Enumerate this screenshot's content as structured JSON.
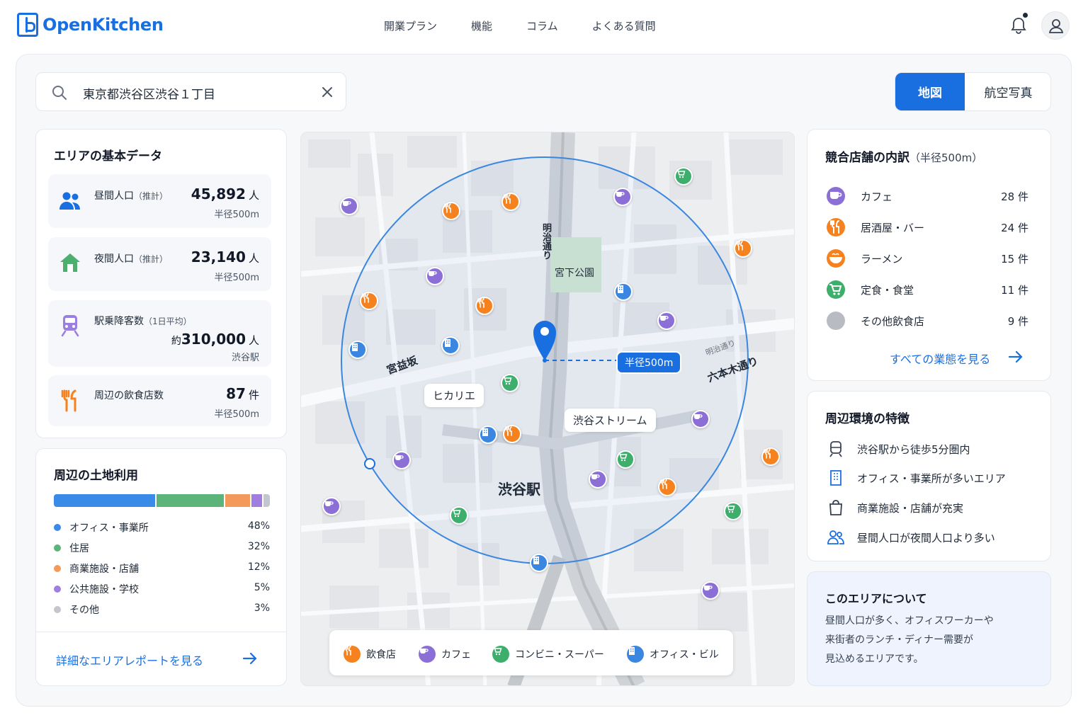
{
  "header": {
    "logo": "OpenKitchen",
    "nav": [
      "開業プラン",
      "機能",
      "コラム",
      "よくある質問"
    ]
  },
  "search": {
    "value": "東京都渋谷区渋谷１丁目"
  },
  "view_toggle": {
    "active": "地図",
    "inactive": "航空写真"
  },
  "basic_data": {
    "title": "エリアの基本データ",
    "items": [
      {
        "label": "昼間人口",
        "note": "（推計）",
        "value": "45,892",
        "unit": "人",
        "sub": "半径500m",
        "icon": "people-icon"
      },
      {
        "label": "夜間人口",
        "note": "（推計）",
        "value": "23,140",
        "unit": "人",
        "sub": "半径500m",
        "icon": "house-icon"
      },
      {
        "label": "駅乗降客数",
        "note": "（1日平均）",
        "prefix": "約",
        "value": "310,000",
        "unit": "人",
        "sub": "渋谷駅",
        "icon": "train-icon"
      },
      {
        "label": "周辺の飲食店数",
        "note": "",
        "value": "87",
        "unit": "件",
        "sub": "半径500m",
        "icon": "fork-knife-icon"
      }
    ]
  },
  "land_use": {
    "title": "周辺の土地利用",
    "items": [
      {
        "name": "オフィス・事業所",
        "percent": "48%",
        "value": 48,
        "color": "#3a8ae8"
      },
      {
        "name": "住居",
        "percent": "32%",
        "value": 32,
        "color": "#5bb47a"
      },
      {
        "name": "商業施設・店舗",
        "percent": "12%",
        "value": 12,
        "color": "#f39a5a"
      },
      {
        "name": "公共施設・学校",
        "percent": "5%",
        "value": 5,
        "color": "#a07ee0"
      },
      {
        "name": "その他",
        "percent": "3%",
        "value": 3,
        "color": "#c3c6cc"
      }
    ],
    "link": "詳細なエリアレポートを見る"
  },
  "map": {
    "station": "渋谷駅",
    "labels": {
      "hikarie": "ヒカリエ",
      "stream": "渋谷ストリーム",
      "park": "宮下公園",
      "miyamasuzaka": "宮益坂",
      "roppongi": "六本木通り",
      "meiji": "明治通り",
      "meiji2": "明治通り"
    },
    "radius_label": "半径500m",
    "legend": [
      {
        "label": "飲食店",
        "icon": "fork-knife-icon"
      },
      {
        "label": "カフェ",
        "icon": "cup-icon"
      },
      {
        "label": "コンビニ・スーパー",
        "icon": "cart-icon"
      },
      {
        "label": "オフィス・ビル",
        "icon": "building-icon"
      }
    ]
  },
  "competitors": {
    "title": "競合店舗の内訳",
    "note": "（半径500m）",
    "items": [
      {
        "name": "カフェ",
        "count": "28 件",
        "color": "#8b6fd6",
        "icon": "cup-icon"
      },
      {
        "name": "居酒屋・バー",
        "count": "24 件",
        "color": "#f5821f",
        "icon": "fork-knife-icon"
      },
      {
        "name": "ラーメン",
        "count": "15 件",
        "color": "#f5821f",
        "icon": "bowl-icon"
      },
      {
        "name": "定食・食堂",
        "count": "11 件",
        "color": "#3dae6b",
        "icon": "cart-icon"
      },
      {
        "name": "その他飲食店",
        "count": "9 件",
        "color": "#b8bcc2",
        "icon": "dot-icon"
      }
    ],
    "link": "すべての業態を見る"
  },
  "environment": {
    "title": "周辺環境の特徴",
    "items": [
      {
        "text": "渋谷駅から徒歩5分圏内",
        "icon": "train-icon"
      },
      {
        "text": "オフィス・事業所が多いエリア",
        "icon": "building-icon"
      },
      {
        "text": "商業施設・店舗が充実",
        "icon": "shopping-bag-icon"
      },
      {
        "text": "昼間人口が夜間人口より多い",
        "icon": "people-icon"
      }
    ]
  },
  "about": {
    "title": "このエリアについて",
    "lines": [
      "昼間人口が多く、オフィスワーカーや",
      "来街者のランチ・ディナー需要が",
      "見込めるエリアです。"
    ]
  }
}
